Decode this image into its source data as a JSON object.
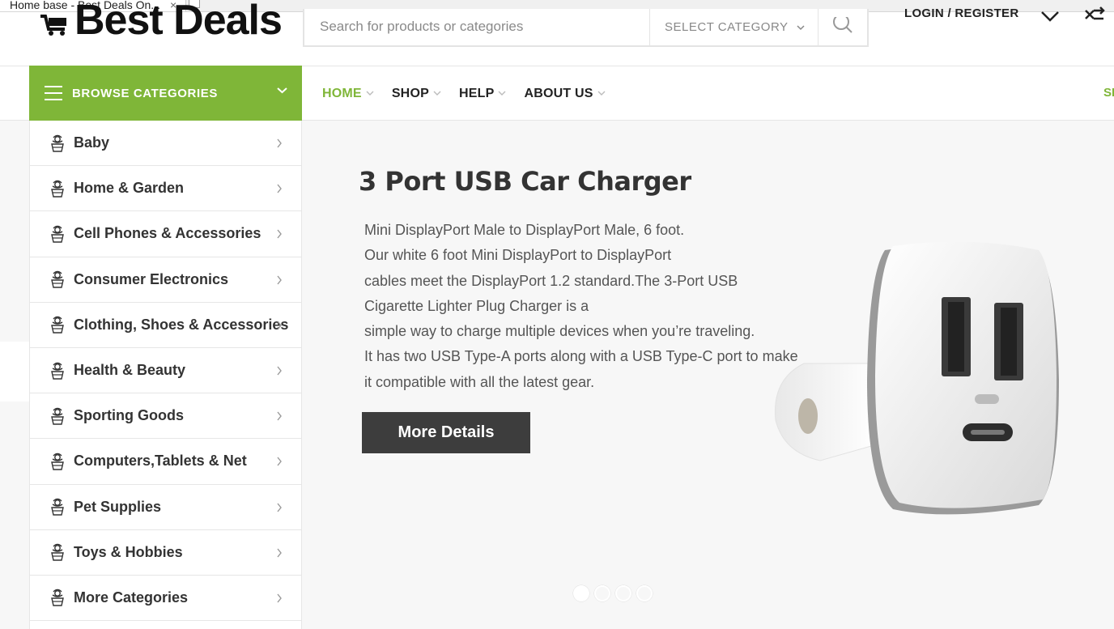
{
  "browser": {
    "tab_title": "Home base - Best Deals On...",
    "tab_close": "×"
  },
  "header": {
    "logo_text": "Best Deals",
    "search_placeholder": "Search for products or categories",
    "category_select": "SELECT CATEGORY",
    "login_register": "LOGIN / REGISTER"
  },
  "nav": {
    "browse_label": "BROWSE CATEGORIES",
    "menu": [
      {
        "label": "HOME",
        "active": true
      },
      {
        "label": "SHOP",
        "active": false
      },
      {
        "label": "HELP",
        "active": false
      },
      {
        "label": "ABOUT US",
        "active": false
      }
    ],
    "extra": "SP",
    "accent_color": "#7fb638"
  },
  "categories": [
    {
      "label": "Baby"
    },
    {
      "label": "Home & Garden"
    },
    {
      "label": "Cell Phones & Accessories"
    },
    {
      "label": "Consumer Electronics"
    },
    {
      "label": "Clothing, Shoes & Accessories"
    },
    {
      "label": "Health & Beauty"
    },
    {
      "label": "Sporting Goods"
    },
    {
      "label": "Computers,Tablets & Net"
    },
    {
      "label": "Pet Supplies"
    },
    {
      "label": "Toys & Hobbies"
    },
    {
      "label": "More Categories"
    }
  ],
  "slide": {
    "title": "3 Port USB Car Charger",
    "description_lines": [
      "Mini DisplayPort Male to DisplayPort Male, 6 foot.",
      "Our white 6 foot Mini DisplayPort to DisplayPort",
      "cables meet the DisplayPort 1.2 standard.The 3-Port USB",
      "Cigarette Lighter Plug Charger is a",
      "simple way to charge multiple devices when you’re traveling.",
      "It has two USB Type-A ports along with a USB Type-C port to make",
      "it compatible with all the latest gear."
    ],
    "button_label": "More Details",
    "slide_count": 4,
    "active_slide": 1
  }
}
